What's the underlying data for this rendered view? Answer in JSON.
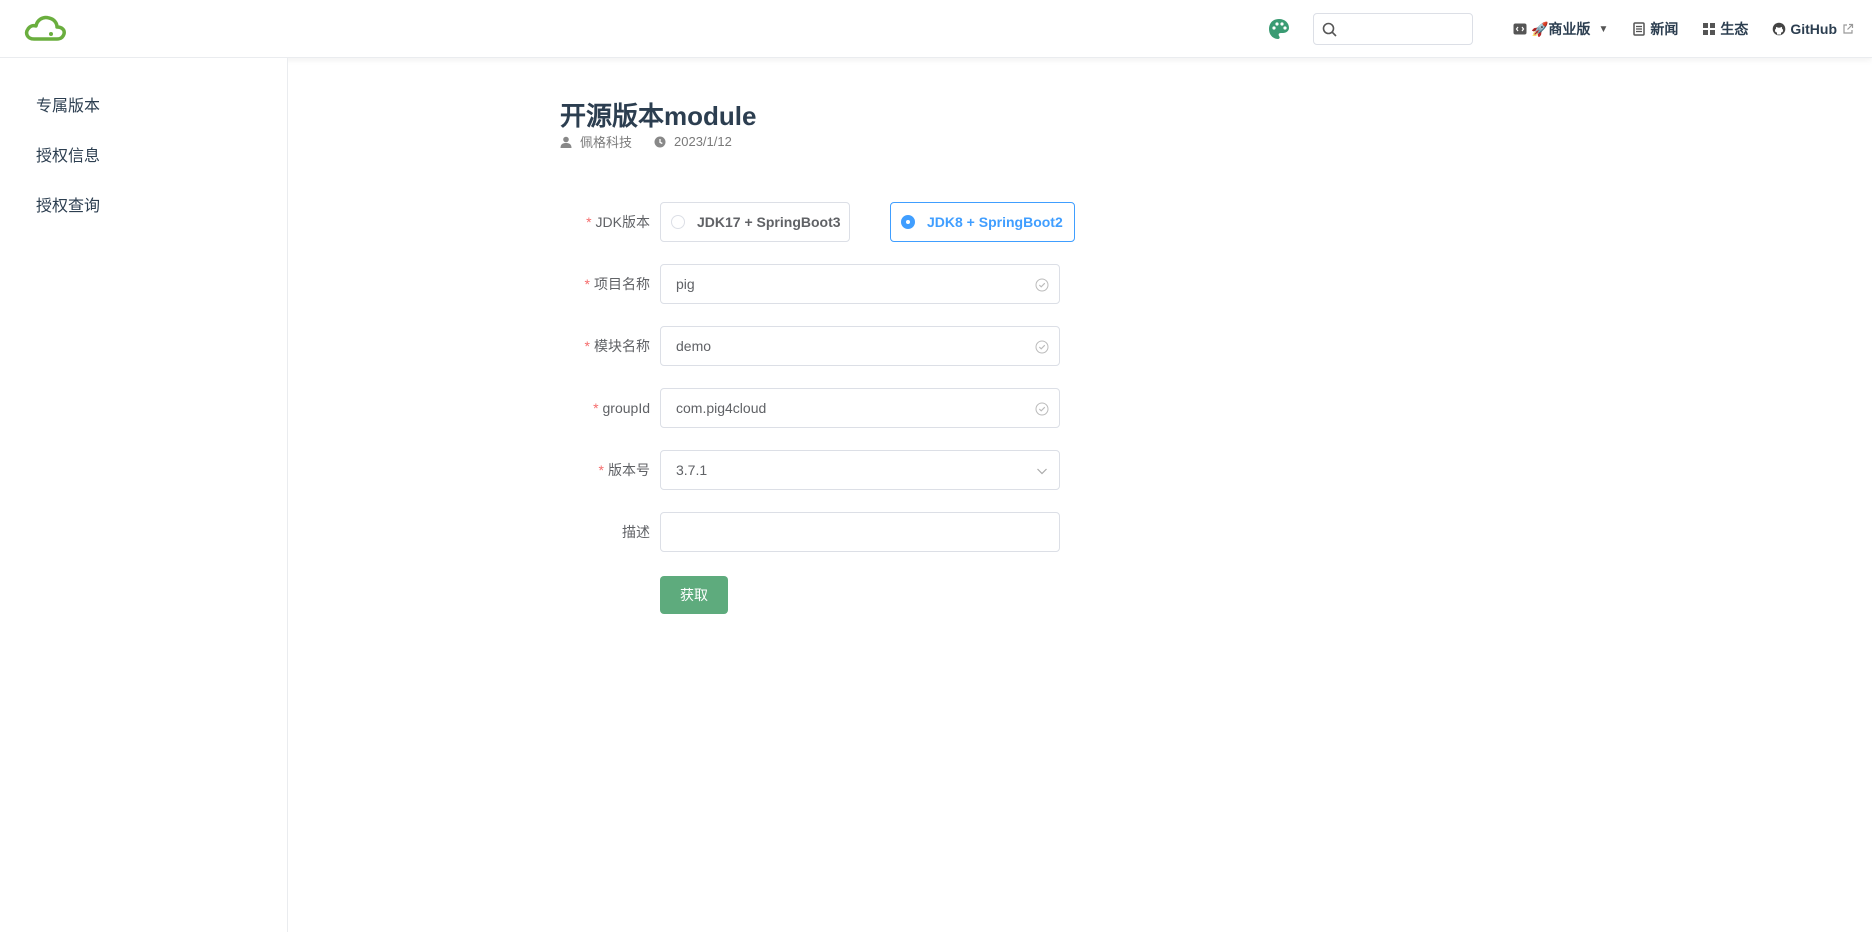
{
  "navbar": {
    "search_placeholder": "",
    "items": [
      {
        "label": "🚀商业版",
        "icon": "code-icon"
      },
      {
        "label": "新闻",
        "icon": "news-icon"
      },
      {
        "label": "生态",
        "icon": "grid-icon"
      },
      {
        "label": "GitHub",
        "icon": "github-icon"
      }
    ],
    "caret": "▼",
    "accent_color": "#5eab7d"
  },
  "sidebar": {
    "items": [
      {
        "label": "专属版本"
      },
      {
        "label": "授权信息"
      },
      {
        "label": "授权查询"
      }
    ]
  },
  "page": {
    "title": "开源版本module",
    "author": "佩格科技",
    "date": "2023/1/12"
  },
  "form": {
    "required_mark": "*",
    "jdk_label": "JDK版本",
    "jdk_options": [
      {
        "label": "JDK17 + SpringBoot3",
        "checked": false
      },
      {
        "label": "JDK8 + SpringBoot2",
        "checked": true
      }
    ],
    "project_label": "项目名称",
    "project_value": "pig",
    "module_label": "模块名称",
    "module_value": "demo",
    "group_label": "groupId",
    "group_value": "com.pig4cloud",
    "version_label": "版本号",
    "version_value": "3.7.1",
    "desc_label": "描述",
    "desc_value": "",
    "submit_label": "获取"
  }
}
